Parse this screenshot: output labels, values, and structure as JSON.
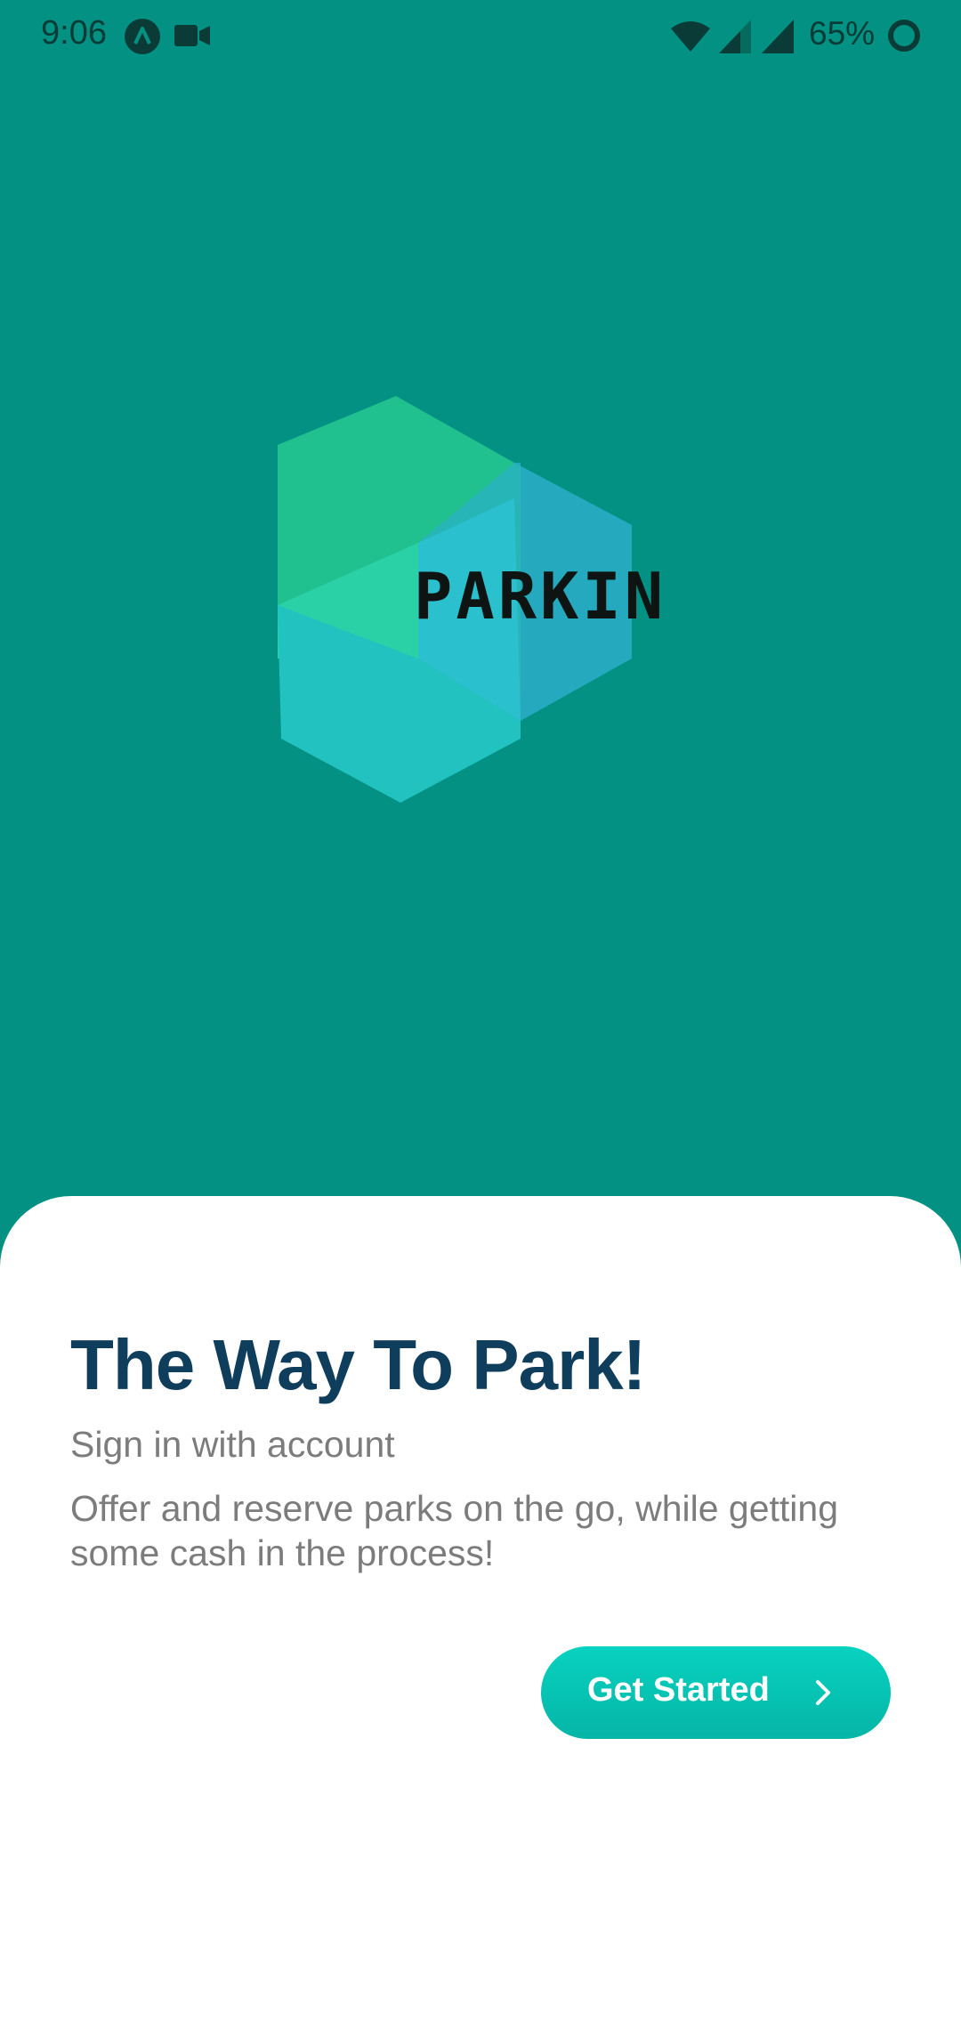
{
  "status_bar": {
    "time": "9:06",
    "battery": "65%",
    "icons": [
      "app-a-icon",
      "video-camera-icon",
      "wifi-icon",
      "signal-icon",
      "signal-icon",
      "battery-ring-icon"
    ]
  },
  "logo": {
    "text": "PARKIN",
    "icon": "hexagon-logo-icon"
  },
  "sheet": {
    "headline": "The Way To Park!",
    "subtitle": "Sign in with account",
    "description": "Offer and reserve parks on the go, while getting some cash in the process!",
    "cta_label": "Get Started",
    "cta_icon": "chevron-right-icon"
  },
  "colors": {
    "background": "#029182",
    "sheet": "#ffffff",
    "headline": "#0f3d5c",
    "body_text": "#7c7c7c",
    "button": "#08d2c0"
  }
}
